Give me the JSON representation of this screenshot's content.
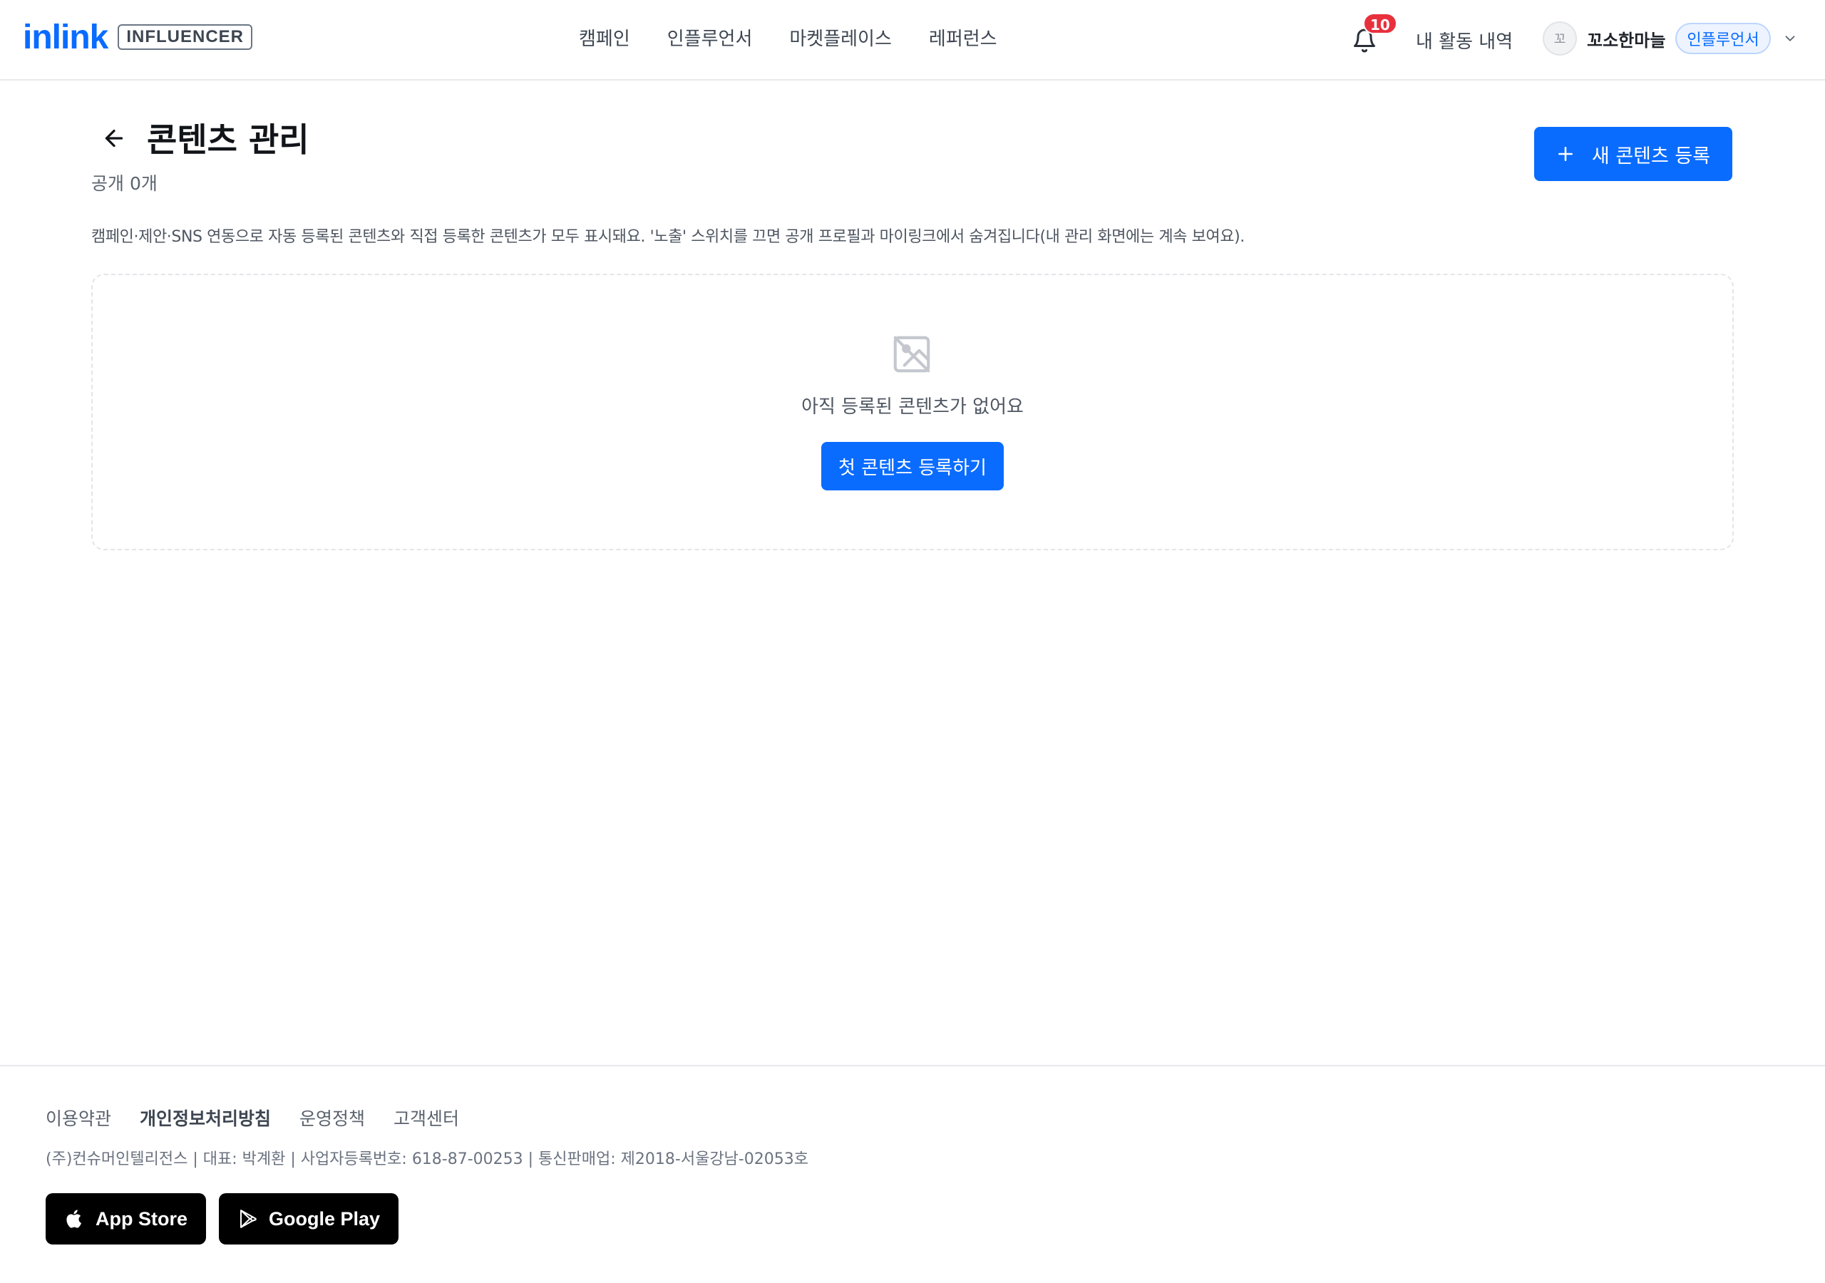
{
  "header": {
    "logo_text": "inlink",
    "logo_badge": "INFLUENCER",
    "nav": [
      {
        "label": "캠페인"
      },
      {
        "label": "인플루언서"
      },
      {
        "label": "마켓플레이스"
      },
      {
        "label": "레퍼런스"
      }
    ],
    "notification_count": "10",
    "activity_label": "내 활동 내역",
    "avatar_text": "꼬",
    "profile_name": "꼬소한마늘",
    "role_badge": "인플루언서"
  },
  "main": {
    "title": "콘텐츠 관리",
    "count_label": "공개 0개",
    "new_button_label": "새 콘텐츠 등록",
    "description": "캠페인·제안·SNS 연동으로 자동 등록된 콘텐츠와 직접 등록한 콘텐츠가 모두 표시돼요. '노출' 스위치를 끄면 공개 프로필과 마이링크에서 숨겨집니다(내 관리 화면에는 계속 보여요).",
    "empty_text": "아직 등록된 콘텐츠가 없어요",
    "first_button_label": "첫 콘텐츠 등록하기"
  },
  "footer": {
    "links": [
      {
        "label": "이용약관"
      },
      {
        "label": "개인정보처리방침"
      },
      {
        "label": "운영정책"
      },
      {
        "label": "고객센터"
      }
    ],
    "company_info": "(주)컨슈머인텔리전스 | 대표: 박계환 | 사업자등록번호: 618-87-00253 | 통신판매업: 제2018-서울강남-02053호",
    "app_store_label": "App Store",
    "google_play_label": "Google Play"
  },
  "colors": {
    "brand": "#0a6cff",
    "badge_red": "#e8303d"
  },
  "icons": [
    "bell-icon",
    "chevron-down-icon",
    "back-arrow-icon",
    "plus-icon",
    "no-image-icon",
    "apple-icon",
    "google-play-icon"
  ]
}
